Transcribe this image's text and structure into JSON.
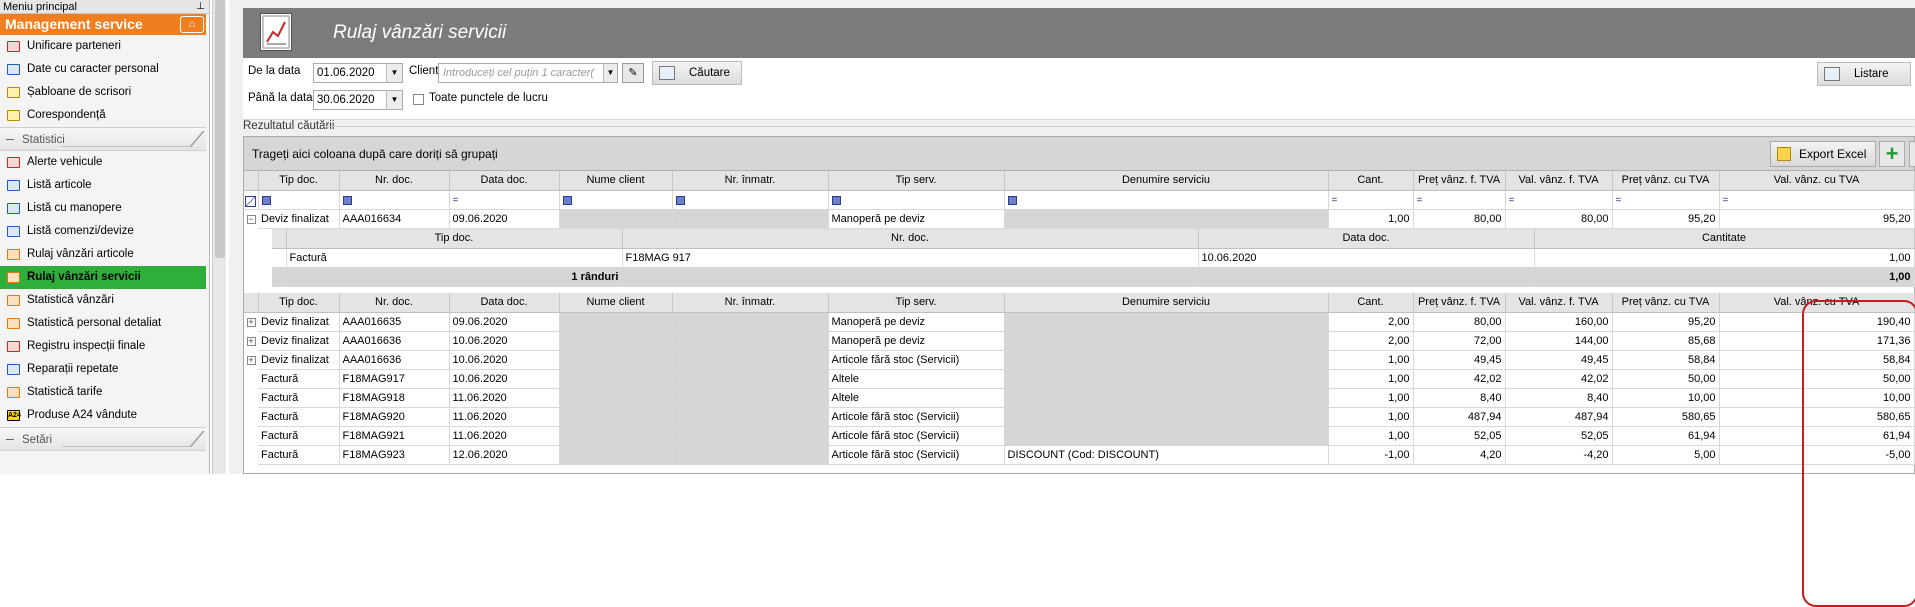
{
  "sidebar": {
    "title": "Meniu principal",
    "group_title": "Management service",
    "items_top": [
      {
        "label": "Unificare parteneri",
        "icon": "partners-icon",
        "color": "red"
      },
      {
        "label": "Date cu caracter personal",
        "icon": "personal-data-icon",
        "color": "blue"
      },
      {
        "label": "Șabloane de scrisori",
        "icon": "letter-template-icon",
        "color": "yellow"
      },
      {
        "label": "Corespondență",
        "icon": "correspondence-icon",
        "color": "yellow"
      }
    ],
    "section_statistici": "Statistici",
    "items_stats": [
      {
        "label": "Alerte vehicule",
        "icon": "vehicle-alert-icon",
        "color": "red"
      },
      {
        "label": "Listă articole",
        "icon": "list-icon",
        "color": "blue"
      },
      {
        "label": "Listă cu manopere",
        "icon": "list-icon",
        "color": "blue"
      },
      {
        "label": "Listă comenzi/devize",
        "icon": "list-icon",
        "color": "blue"
      },
      {
        "label": "Rulaj vânzări articole",
        "icon": "sales-chart-icon",
        "color": "orange"
      },
      {
        "label": "Rulaj vânzări servicii",
        "icon": "sales-chart-icon",
        "color": "orange",
        "active": true
      },
      {
        "label": "Statistică vânzări",
        "icon": "stats-icon",
        "color": "orange"
      },
      {
        "label": "Statistică personal detaliat",
        "icon": "stats-icon",
        "color": "orange"
      },
      {
        "label": "Registru inspecții finale",
        "icon": "register-icon",
        "color": "red"
      },
      {
        "label": "Reparații repetate",
        "icon": "repair-icon",
        "color": "blue"
      },
      {
        "label": "Statistică tarife",
        "icon": "stats-icon",
        "color": "orange"
      },
      {
        "label": "Produse A24 vândute",
        "icon": "a24-icon",
        "color": "black",
        "icon_text": "A24"
      }
    ],
    "section_setari": "Setări"
  },
  "header": {
    "title": "Rulaj vânzări servicii"
  },
  "filters": {
    "from_label": "De la data",
    "from_value": "01.06.2020",
    "to_label": "Până la data",
    "to_value": "30.06.2020",
    "client_label": "Client",
    "client_placeholder": "Introduceți cel puțin 1 caracter(",
    "search_label": "Căutare",
    "all_workpoints_label": "Toate punctele de lucru",
    "list_label": "Listare"
  },
  "results_label": "Rezultatul căutării",
  "grid": {
    "group_hint": "Trageți aici coloana după care doriți să grupați",
    "export_label": "Export Excel",
    "columns": [
      "Tip doc.",
      "Nr. doc.",
      "Data doc.",
      "Nume client",
      "Nr. înmatr.",
      "Tip serv.",
      "Denumire serviciu",
      "Cant.",
      "Preț vânz. f. TVA",
      "Val. vânz. f. TVA",
      "Preț vânz. cu TVA",
      "Val. vânz. cu TVA"
    ],
    "first_row": {
      "tip": "Deviz finalizat",
      "nr": "AAA016634",
      "data": "09.06.2020",
      "tipserv": "Manoperă pe deviz",
      "den": "",
      "cant": "1,00",
      "pret": "80,00",
      "val": "80,00",
      "pretTva": "95,20",
      "valTva": "95,20"
    },
    "detail": {
      "columns": [
        "Tip doc.",
        "Nr. doc.",
        "Data doc.",
        "Cantitate"
      ],
      "row": [
        "Factură",
        "F18MAG 917",
        "10.06.2020",
        "1,00"
      ],
      "summary_label": "1 rânduri",
      "summary_value": "1,00"
    },
    "rows": [
      {
        "exp": true,
        "tip": "Deviz finalizat",
        "nr": "AAA016635",
        "data": "09.06.2020",
        "tipserv": "Manoperă pe deviz",
        "den": "",
        "cant": "2,00",
        "pret": "80,00",
        "val": "160,00",
        "pretTva": "95,20",
        "valTva": "190,40"
      },
      {
        "exp": true,
        "tip": "Deviz finalizat",
        "nr": "AAA016636",
        "data": "10.06.2020",
        "tipserv": "Manoperă pe deviz",
        "den": "",
        "cant": "2,00",
        "pret": "72,00",
        "val": "144,00",
        "pretTva": "85,68",
        "valTva": "171,36"
      },
      {
        "exp": true,
        "tip": "Deviz finalizat",
        "nr": "AAA016636",
        "data": "10.06.2020",
        "tipserv": "Articole fără stoc (Servicii)",
        "den": "",
        "cant": "1,00",
        "pret": "49,45",
        "val": "49,45",
        "pretTva": "58,84",
        "valTva": "58,84"
      },
      {
        "exp": false,
        "tip": "Factură",
        "nr": "F18MAG917",
        "data": "10.06.2020",
        "tipserv": "Altele",
        "den": "",
        "cant": "1,00",
        "pret": "42,02",
        "val": "42,02",
        "pretTva": "50,00",
        "valTva": "50,00"
      },
      {
        "exp": false,
        "tip": "Factură",
        "nr": "F18MAG918",
        "data": "11.06.2020",
        "tipserv": "Altele",
        "den": "",
        "cant": "1,00",
        "pret": "8,40",
        "val": "8,40",
        "pretTva": "10,00",
        "valTva": "10,00"
      },
      {
        "exp": false,
        "tip": "Factură",
        "nr": "F18MAG920",
        "data": "11.06.2020",
        "tipserv": "Articole fără stoc (Servicii)",
        "den": "",
        "cant": "1,00",
        "pret": "487,94",
        "val": "487,94",
        "pretTva": "580,65",
        "valTva": "580,65"
      },
      {
        "exp": false,
        "tip": "Factură",
        "nr": "F18MAG921",
        "data": "11.06.2020",
        "tipserv": "Articole fără stoc (Servicii)",
        "den": "",
        "cant": "1,00",
        "pret": "52,05",
        "val": "52,05",
        "pretTva": "61,94",
        "valTva": "61,94"
      },
      {
        "exp": false,
        "tip": "Factură",
        "nr": "F18MAG923",
        "data": "12.06.2020",
        "tipserv": "Articole fără stoc (Servicii)",
        "den": "DISCOUNT (Cod: DISCOUNT)",
        "cant": "-1,00",
        "pret": "4,20",
        "val": "-4,20",
        "pretTva": "5,00",
        "valTva": "-5,00"
      }
    ]
  },
  "colors": {
    "accent": "#f07e1f",
    "active": "#2fae3b",
    "highlight": "#c21e1e"
  }
}
